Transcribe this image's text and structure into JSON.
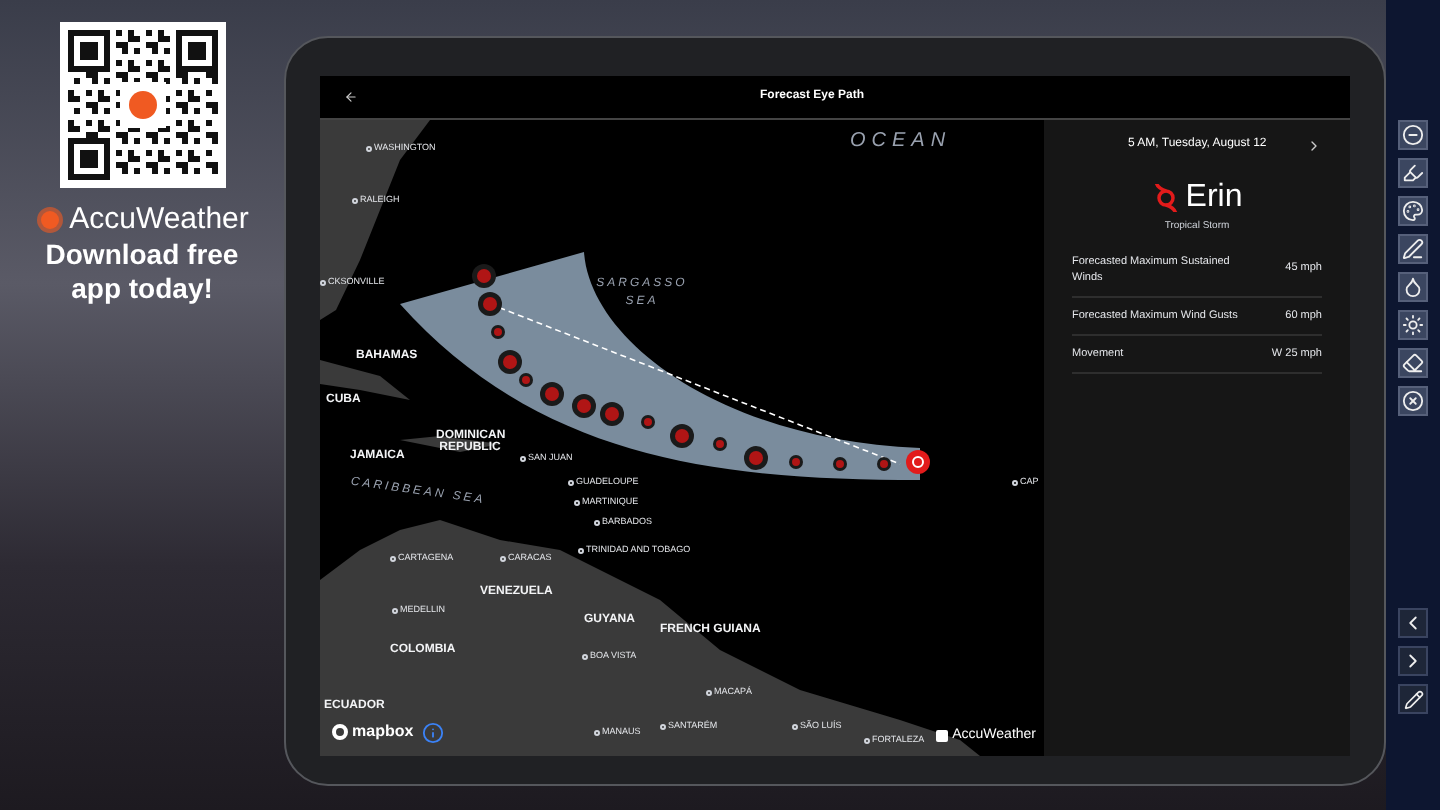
{
  "promo": {
    "brand": "AccuWeather",
    "text": "Download free app today!"
  },
  "app": {
    "title": "Forecast Eye Path"
  },
  "map": {
    "places": [
      {
        "name": "OCEAN",
        "kind": "water"
      },
      {
        "name": "WASHINGTON",
        "kind": "city"
      },
      {
        "name": "RALEIGH",
        "kind": "city"
      },
      {
        "name": "CKSONVILLE",
        "kind": "city"
      },
      {
        "name": "BAHAMAS",
        "kind": "country"
      },
      {
        "name": "CUBA",
        "kind": "country"
      },
      {
        "name": "SARGASSO SEA",
        "kind": "water"
      },
      {
        "name": "DOMINICAN REPUBLIC",
        "kind": "country"
      },
      {
        "name": "SAN JUAN",
        "kind": "city"
      },
      {
        "name": "JAMAICA",
        "kind": "country"
      },
      {
        "name": "CARIBBEAN SEA",
        "kind": "water"
      },
      {
        "name": "GUADELOUPE",
        "kind": "city"
      },
      {
        "name": "MARTINIQUE",
        "kind": "city"
      },
      {
        "name": "BARBADOS",
        "kind": "city"
      },
      {
        "name": "CARTAGENA",
        "kind": "city"
      },
      {
        "name": "CARACAS",
        "kind": "city"
      },
      {
        "name": "TRINIDAD AND TOBAGO",
        "kind": "city"
      },
      {
        "name": "VENEZUELA",
        "kind": "country"
      },
      {
        "name": "GUYANA",
        "kind": "country"
      },
      {
        "name": "FRENCH GUIANA",
        "kind": "country"
      },
      {
        "name": "MEDELLIN",
        "kind": "city"
      },
      {
        "name": "COLOMBIA",
        "kind": "country"
      },
      {
        "name": "BOA VISTA",
        "kind": "city"
      },
      {
        "name": "ECUADOR",
        "kind": "country"
      },
      {
        "name": "MACAPÁ",
        "kind": "city"
      },
      {
        "name": "MANAUS",
        "kind": "city"
      },
      {
        "name": "SANTARÉM",
        "kind": "city"
      },
      {
        "name": "SÃO LUÍS",
        "kind": "city"
      },
      {
        "name": "FORTALEZA",
        "kind": "city"
      },
      {
        "name": "CAP",
        "kind": "city"
      }
    ],
    "attribution": "mapbox",
    "watermark": "AccuWeather"
  },
  "panel": {
    "date": "5 AM, Tuesday, August 12",
    "storm_name": "Erin",
    "storm_type": "Tropical Storm",
    "stats": [
      {
        "label": "Forecasted Maximum Sustained Winds",
        "value": "45 mph"
      },
      {
        "label": "Forecasted Maximum Wind Gusts",
        "value": "60 mph"
      },
      {
        "label": "Movement",
        "value": "W 25 mph"
      }
    ]
  }
}
